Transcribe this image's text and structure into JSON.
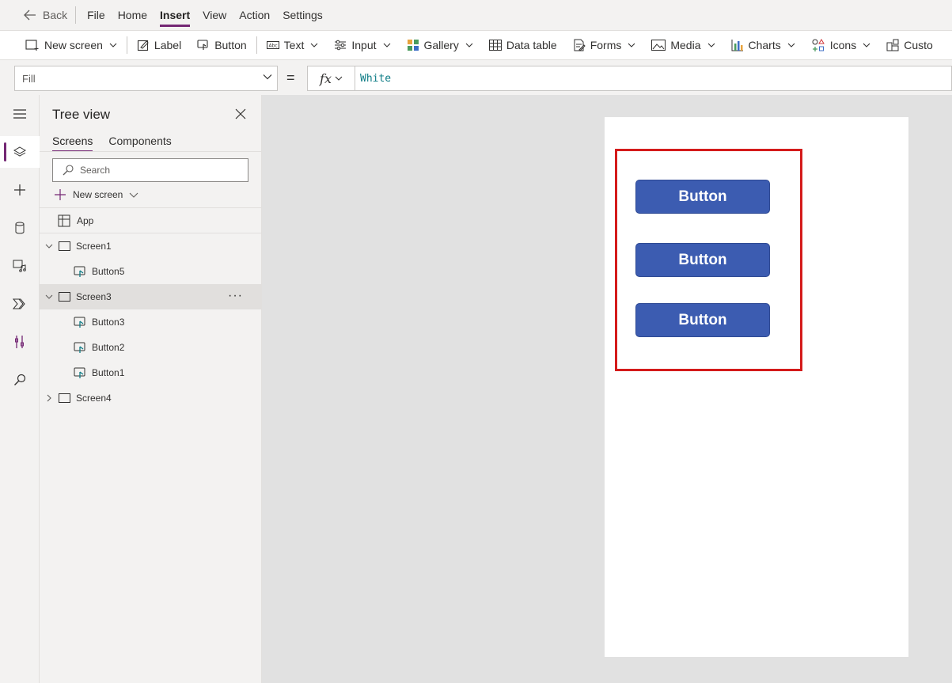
{
  "menubar": {
    "back_label": "Back",
    "items": [
      "File",
      "Home",
      "Insert",
      "View",
      "Action",
      "Settings"
    ],
    "active": "Insert"
  },
  "ribbon": {
    "new_screen": "New screen",
    "label": "Label",
    "button": "Button",
    "text": "Text",
    "input": "Input",
    "gallery": "Gallery",
    "data_table": "Data table",
    "forms": "Forms",
    "media": "Media",
    "charts": "Charts",
    "icons": "Icons",
    "custom": "Custo"
  },
  "formula_bar": {
    "property": "Fill",
    "equals": "=",
    "fx": "fx",
    "formula": "White"
  },
  "tree_view": {
    "title": "Tree view",
    "tabs": [
      "Screens",
      "Components"
    ],
    "active_tab": "Screens",
    "search_placeholder": "Search",
    "new_screen_label": "New screen",
    "nodes": {
      "app": "App",
      "screen1": "Screen1",
      "button5": "Button5",
      "screen3": "Screen3",
      "button3": "Button3",
      "button2": "Button2",
      "button1": "Button1",
      "screen4": "Screen4"
    },
    "more": "···"
  },
  "canvas": {
    "buttons": [
      "Button",
      "Button",
      "Button"
    ],
    "button_color": "#3c5cb1",
    "selection_color": "#d41b1b"
  },
  "colors": {
    "accent": "#742774",
    "formula_text": "#0e7c86"
  }
}
